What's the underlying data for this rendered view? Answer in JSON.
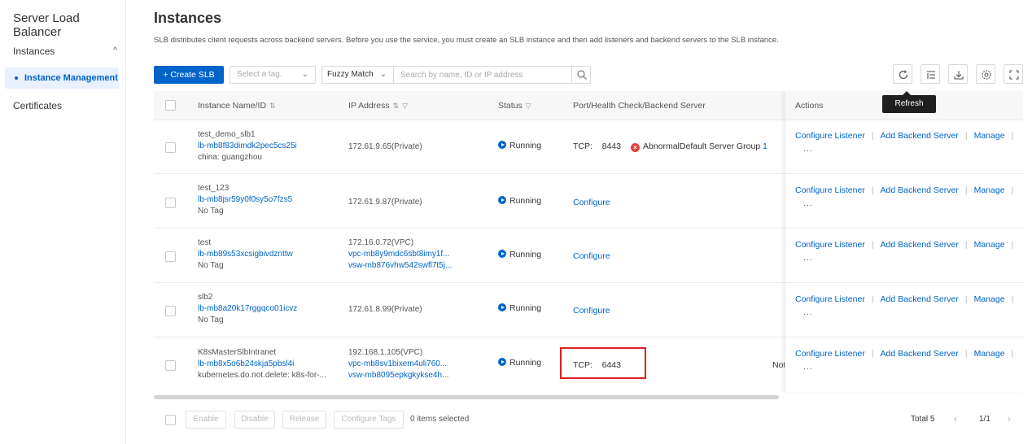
{
  "sidebar": {
    "title": "Server Load Balancer",
    "group_label": "Instances",
    "active_item": "Instance Management",
    "item_certificates": "Certificates"
  },
  "page": {
    "title": "Instances",
    "description": "SLB distributes client requests across backend servers. Before you use the service, you must create an SLB instance and then add listeners and backend servers to the SLB instance."
  },
  "toolbar": {
    "create_label": "+ Create SLB",
    "tag_placeholder": "Select a tag.",
    "match_mode": "Fuzzy Match",
    "search_placeholder": "Search by name, ID or IP address",
    "tooltip": "Refresh"
  },
  "table": {
    "headers": {
      "name": "Instance Name/ID",
      "ip": "IP Address",
      "status": "Status",
      "port": "Port/Health Check/Backend Server",
      "actions": "Actions"
    },
    "action_labels": {
      "configure_listener": "Configure Listener",
      "add_backend": "Add Backend Server",
      "manage": "Manage",
      "more": "..."
    },
    "rows": [
      {
        "name": "test_demo_slb1",
        "id": "lb-mb8f83dimdk2pec5cs25i",
        "tag": "china: guangzhou",
        "ip1": "172.61.9.65(Private)",
        "ip2": "",
        "ip3": "",
        "status": "Running",
        "port_proto": "TCP:",
        "port_num": "8443",
        "health": "Abnormal",
        "group": "Default Server Group",
        "group_count": "1",
        "configure": ""
      },
      {
        "name": "test_123",
        "id": "lb-mb8jsr59y0f0sy5o7fzs5",
        "tag": "No Tag",
        "ip1": "172.61.9.87(Private)",
        "ip2": "",
        "ip3": "",
        "status": "Running",
        "configure": "Configure"
      },
      {
        "name": "test",
        "id": "lb-mb89s53xcsigbivdznttw",
        "tag": "No Tag",
        "ip1": "172.16.0.72(VPC)",
        "ip2": "vpc-mb8y9mdc6sbt8imy1f...",
        "ip3": "vsw-mb876vhw542swfl7t5j...",
        "status": "Running",
        "configure": "Configure"
      },
      {
        "name": "slb2",
        "id": "lb-mb8a20k17rggqco01icvz",
        "tag": "No Tag",
        "ip1": "172.61.8.99(Private)",
        "ip2": "",
        "ip3": "",
        "status": "Running",
        "configure": "Configure"
      },
      {
        "name": "K8sMasterSlbIntranet",
        "id": "lb-mb8x5o6b24skja5pbsl4i",
        "tag": "kubernetes.do.not.delete: k8s-for-...",
        "ip1": "192.168.1.105(VPC)",
        "ip2": "vpc-mb8sv1bixem4uli760...",
        "ip3": "vsw-mb8095epkgkykse4h...",
        "status": "Running",
        "port_proto": "TCP:",
        "port_num": "6443",
        "trailing": "Not"
      }
    ]
  },
  "footer": {
    "enable": "Enable",
    "disable": "Disable",
    "release": "Release",
    "configure_tags": "Configure Tags",
    "selected": "0 items selected",
    "total": "Total 5",
    "page": "1/1"
  },
  "colors": {
    "primary": "#0064c8",
    "error": "#e0443a",
    "highlight": "#e02020"
  }
}
